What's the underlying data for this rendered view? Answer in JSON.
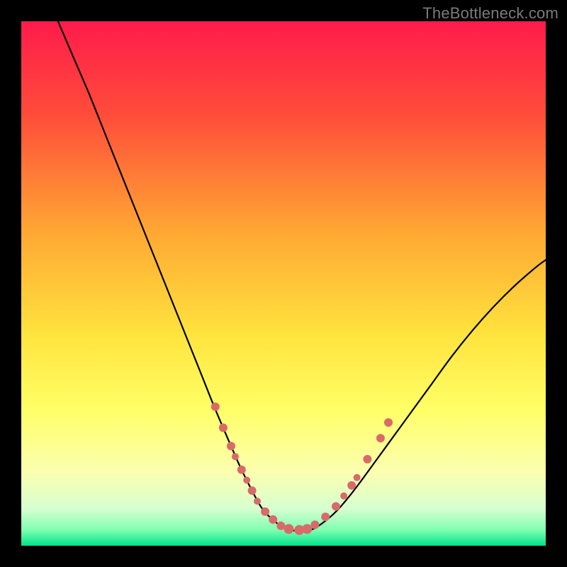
{
  "watermark": "TheBottleneck.com",
  "chart_data": {
    "type": "line",
    "title": "",
    "xlabel": "",
    "ylabel": "",
    "xlim": [
      0,
      100
    ],
    "ylim": [
      0,
      100
    ],
    "grid": false,
    "legend": false,
    "background_gradient": {
      "stops": [
        {
          "offset": 0.0,
          "color": "#ff1b4b"
        },
        {
          "offset": 0.18,
          "color": "#ff4d3a"
        },
        {
          "offset": 0.4,
          "color": "#ffa733"
        },
        {
          "offset": 0.6,
          "color": "#ffe43e"
        },
        {
          "offset": 0.74,
          "color": "#ffff66"
        },
        {
          "offset": 0.86,
          "color": "#fbffb0"
        },
        {
          "offset": 0.93,
          "color": "#d6ffd0"
        },
        {
          "offset": 0.97,
          "color": "#7fffb0"
        },
        {
          "offset": 1.0,
          "color": "#00e28a"
        }
      ]
    },
    "series": [
      {
        "name": "bottleneck-curve",
        "color": "#000000",
        "x": [
          7,
          10,
          13,
          16,
          19,
          22,
          25,
          28,
          31,
          34,
          37,
          40,
          42,
          44,
          46,
          48.5,
          51,
          53,
          55,
          57,
          60,
          63,
          66,
          70,
          74,
          78,
          82,
          86,
          90,
          94,
          98,
          100
        ],
        "y": [
          100,
          93,
          86,
          78.5,
          71,
          63.5,
          56,
          48.5,
          41,
          33.5,
          26,
          19,
          14.5,
          10.5,
          7,
          4.5,
          3,
          3,
          3,
          4,
          6.5,
          10,
          14,
          19.5,
          25,
          30.5,
          36,
          41,
          45.5,
          49.5,
          53,
          54.5
        ]
      }
    ],
    "markers": {
      "color": "#d96a6a",
      "radius_small": 5,
      "radius_large": 7,
      "points": [
        {
          "x": 37.0,
          "y": 26.5,
          "r": 6
        },
        {
          "x": 38.5,
          "y": 22.5,
          "r": 6
        },
        {
          "x": 40.0,
          "y": 19.0,
          "r": 6
        },
        {
          "x": 40.8,
          "y": 17.0,
          "r": 5
        },
        {
          "x": 42.0,
          "y": 14.5,
          "r": 6
        },
        {
          "x": 43.0,
          "y": 12.5,
          "r": 5
        },
        {
          "x": 44.0,
          "y": 10.5,
          "r": 6
        },
        {
          "x": 45.0,
          "y": 8.5,
          "r": 5
        },
        {
          "x": 46.5,
          "y": 6.5,
          "r": 6
        },
        {
          "x": 48.0,
          "y": 5.0,
          "r": 6
        },
        {
          "x": 49.5,
          "y": 3.8,
          "r": 6
        },
        {
          "x": 51.0,
          "y": 3.2,
          "r": 7
        },
        {
          "x": 53.0,
          "y": 3.0,
          "r": 7
        },
        {
          "x": 54.5,
          "y": 3.2,
          "r": 7
        },
        {
          "x": 56.0,
          "y": 4.0,
          "r": 6
        },
        {
          "x": 58.0,
          "y": 5.5,
          "r": 6
        },
        {
          "x": 60.0,
          "y": 7.5,
          "r": 6
        },
        {
          "x": 61.5,
          "y": 9.5,
          "r": 5
        },
        {
          "x": 63.0,
          "y": 11.5,
          "r": 6
        },
        {
          "x": 64.0,
          "y": 13.0,
          "r": 5
        },
        {
          "x": 66.0,
          "y": 16.5,
          "r": 6
        },
        {
          "x": 68.5,
          "y": 20.5,
          "r": 6
        },
        {
          "x": 70.0,
          "y": 23.5,
          "r": 6
        }
      ]
    }
  }
}
